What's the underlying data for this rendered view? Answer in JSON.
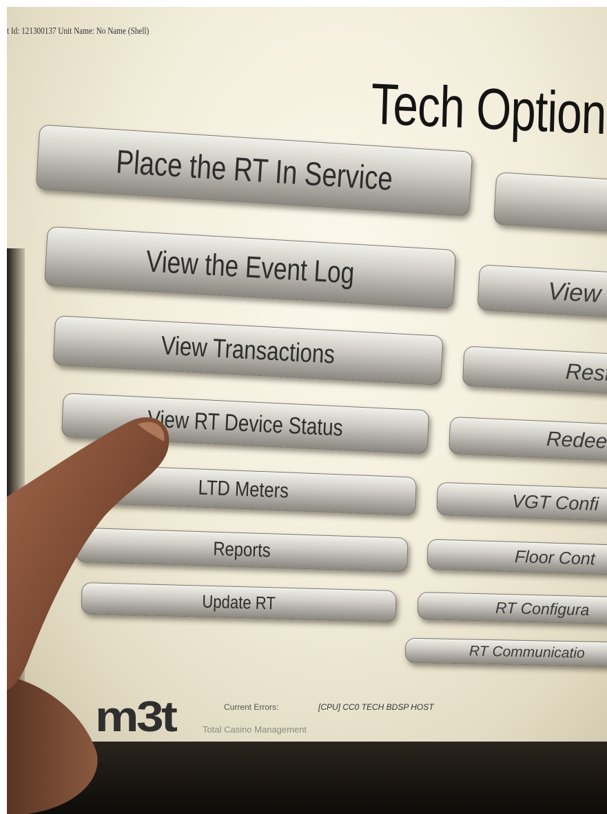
{
  "header": {
    "info": "t Id: 121300137  Unit Name: No Name (Shell)",
    "title": "Tech Option"
  },
  "left_buttons": [
    "Place the RT In Service",
    "View the Event Log",
    "View Transactions",
    "View RT Device Status",
    "LTD Meters",
    "Reports",
    "Update RT"
  ],
  "right_buttons": [
    "",
    "View",
    "Rest",
    "Redee",
    "VGT Confi",
    "Floor Cont",
    "RT Configura",
    "RT Communicatio"
  ],
  "footer": {
    "logo": "m3t",
    "errors_label": "Current Errors:",
    "errors_value": "[CPU] CC0 TECH BDSP HOST",
    "tagline": "Total Casino Management"
  }
}
